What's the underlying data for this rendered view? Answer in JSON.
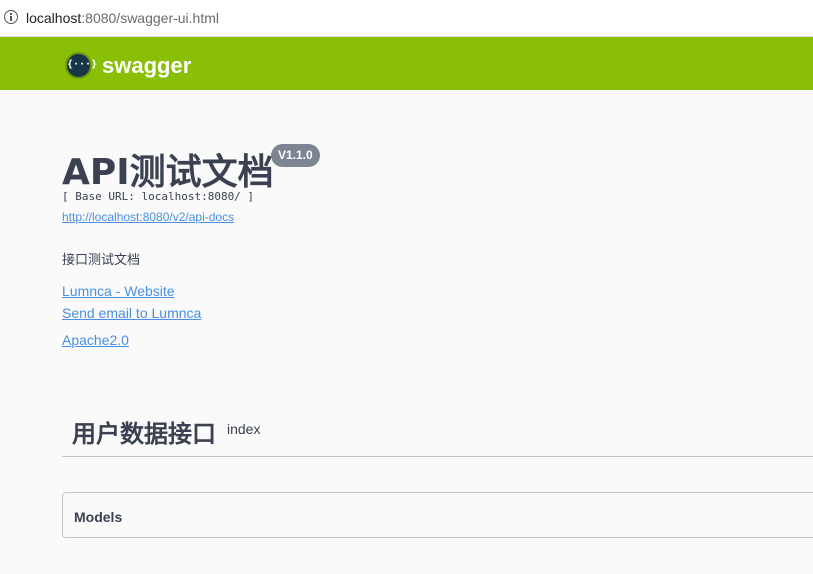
{
  "browser": {
    "url_host": "localhost",
    "url_rest": ":8080/swagger-ui.html"
  },
  "topbar": {
    "logo_glyph": "{···}",
    "logo_text": "swagger",
    "color": "#89bf04"
  },
  "info": {
    "title": "API测试文档",
    "version": "V1.1.0",
    "base_url": "[ Base URL: localhost:8080/ ]",
    "api_docs_link": "http://localhost:8080/v2/api-docs",
    "description": "接口测试文档",
    "website_link": "Lumnca - Website",
    "email_link": "Send email to Lumnca",
    "license_link": "Apache2.0"
  },
  "tags": [
    {
      "name": "用户数据接口",
      "description": "index"
    }
  ],
  "models": {
    "title": "Models"
  }
}
